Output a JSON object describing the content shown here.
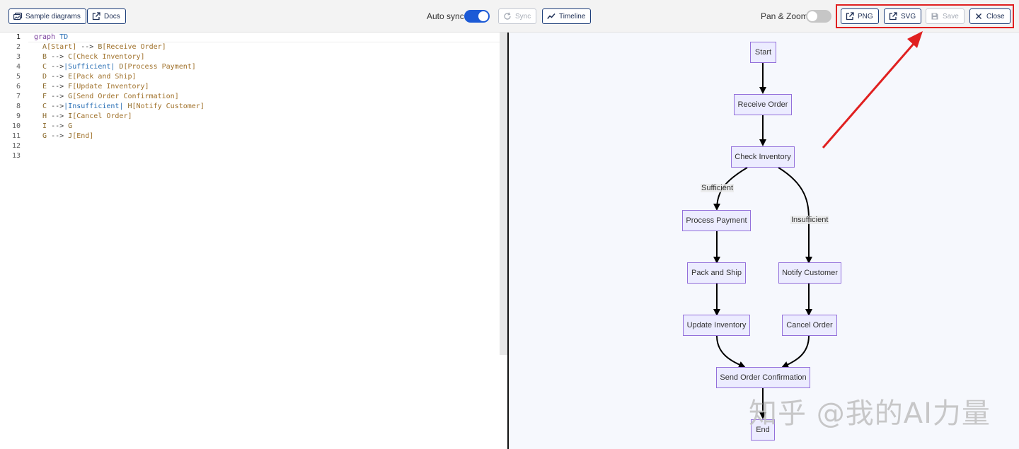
{
  "toolbar": {
    "sample_diagrams": "Sample diagrams",
    "docs": "Docs",
    "auto_sync_label": "Auto sync",
    "auto_sync_on": true,
    "sync": "Sync",
    "timeline": "Timeline",
    "pan_zoom_label": "Pan & Zoom",
    "pan_zoom_on": false,
    "png": "PNG",
    "svg": "SVG",
    "save": "Save",
    "close": "Close"
  },
  "editor": {
    "line_numbers": [
      "1",
      "2",
      "3",
      "4",
      "5",
      "6",
      "7",
      "8",
      "9",
      "10",
      "11",
      "12",
      "13"
    ],
    "lines": [
      "graph TD",
      "  A[Start] --> B[Receive Order]",
      "  B --> C[Check Inventory]",
      "  C -->|Sufficient| D[Process Payment]",
      "  D --> E[Pack and Ship]",
      "  E --> F[Update Inventory]",
      "  F --> G[Send Order Confirmation]",
      "  C -->|Insufficient| H[Notify Customer]",
      "  H --> I[Cancel Order]",
      "  I --> G",
      "  G --> J[End]",
      "",
      ""
    ]
  },
  "diagram": {
    "nodes": {
      "start": "Start",
      "receive_order": "Receive Order",
      "check_inventory": "Check Inventory",
      "process_payment": "Process Payment",
      "pack_ship": "Pack and Ship",
      "update_inventory": "Update Inventory",
      "notify_customer": "Notify Customer",
      "cancel_order": "Cancel Order",
      "send_confirmation": "Send Order Confirmation",
      "end": "End"
    },
    "edge_labels": {
      "sufficient": "Sufficient",
      "insufficient": "Insufficient"
    },
    "node_fill": "#ececff",
    "node_border": "#9370db"
  },
  "watermark": "知乎 @我的AI力量",
  "annotation_color": "#e02020"
}
